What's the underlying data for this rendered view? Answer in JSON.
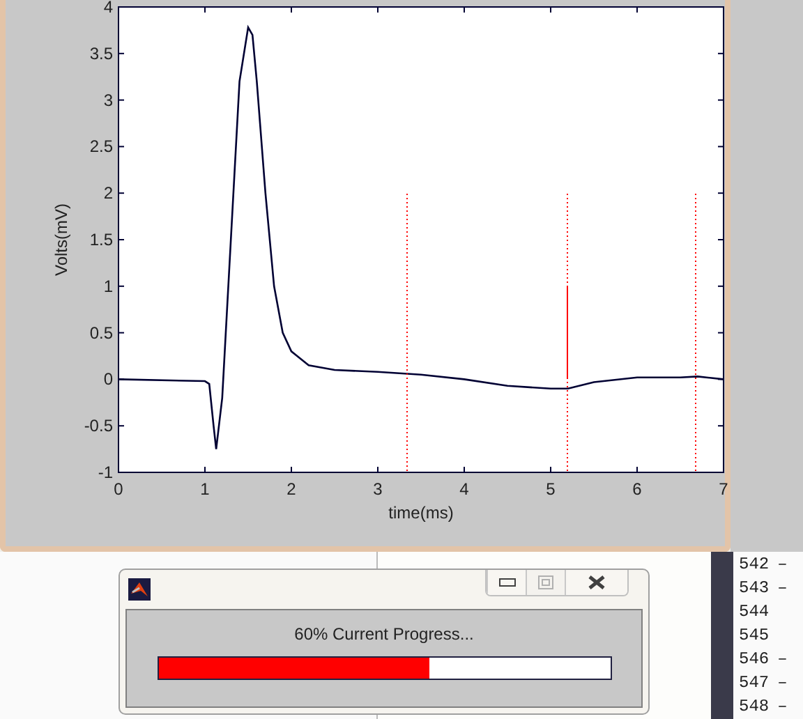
{
  "figure": {
    "chart_data": {
      "type": "line",
      "xlabel": "time(ms)",
      "ylabel": "Volts(mV)",
      "xlim": [
        0,
        7
      ],
      "ylim": [
        -1,
        4
      ],
      "xticks": [
        0,
        1,
        2,
        3,
        4,
        5,
        6,
        7
      ],
      "yticks": [
        -1,
        {
          "value": -0.5,
          "label": "-0.5"
        },
        0,
        {
          "value": 0.5,
          "label": "0.5"
        },
        1,
        {
          "value": 1.5,
          "label": "1.5"
        },
        2,
        {
          "value": 2.5,
          "label": "2.5"
        },
        3,
        {
          "value": 3.5,
          "label": "3.5"
        },
        4
      ],
      "x": [
        0,
        1.0,
        1.05,
        1.1,
        1.13,
        1.2,
        1.3,
        1.4,
        1.5,
        1.55,
        1.6,
        1.7,
        1.8,
        1.9,
        2.0,
        2.2,
        2.5,
        3.0,
        3.5,
        4.0,
        4.5,
        5.0,
        5.2,
        5.5,
        6.0,
        6.5,
        6.7,
        7
      ],
      "series": [
        {
          "color": "#000033",
          "values": [
            0,
            -0.02,
            -0.05,
            -0.5,
            -0.75,
            -0.2,
            1.5,
            3.2,
            3.78,
            3.7,
            3.2,
            2.0,
            1.0,
            0.5,
            0.3,
            0.15,
            0.1,
            0.08,
            0.05,
            0.0,
            -0.07,
            -0.1,
            -0.1,
            -0.03,
            0.02,
            0.02,
            0.03,
            0
          ]
        }
      ]
    }
  },
  "editor": {
    "line_numbers": [
      {
        "number": "542",
        "marker": "–"
      },
      {
        "number": "543",
        "marker": "–"
      },
      {
        "number": "544"
      },
      {
        "number": "545"
      },
      {
        "number": "546",
        "marker": "–"
      },
      {
        "number": "547",
        "marker": "–"
      },
      {
        "number": "548",
        "marker": "–"
      }
    ]
  },
  "progress_dialog": {
    "message": "60% Current Progress...",
    "level": 0.6,
    "buttons": [
      {
        "kind": "minimize",
        "disabled": false
      },
      {
        "kind": "maximize",
        "disabled": true
      },
      {
        "kind": "close",
        "disabled": false
      }
    ]
  }
}
